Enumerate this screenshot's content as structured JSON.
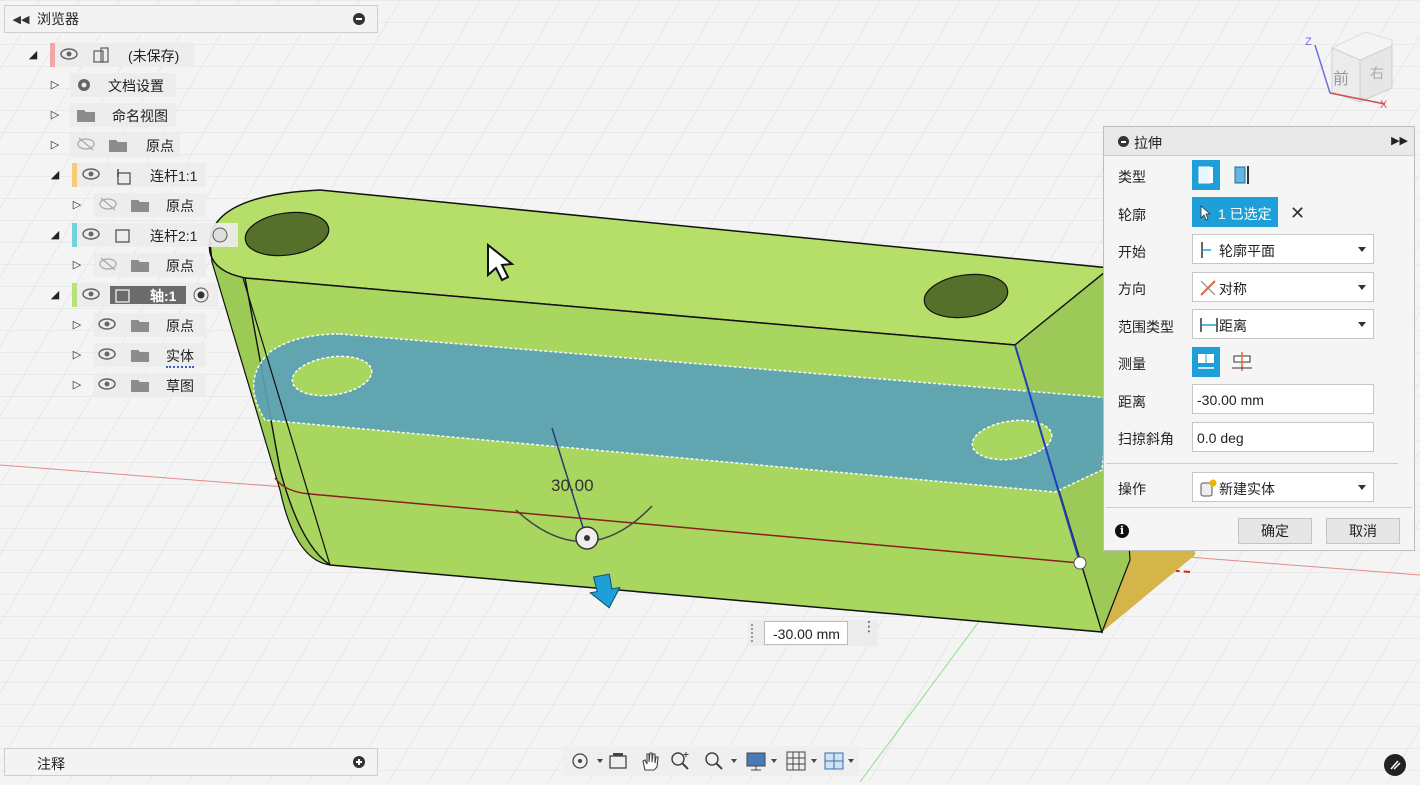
{
  "browser": {
    "title": "浏览器",
    "tree": [
      {
        "label": "(未保存)",
        "indent": 0,
        "color": "#f4a6a6"
      },
      {
        "label": "文档设置",
        "indent": 1
      },
      {
        "label": "命名视图",
        "indent": 1
      },
      {
        "label": "原点",
        "indent": 1
      },
      {
        "label": "连杆1:1",
        "indent": 1,
        "color": "#f7c97a"
      },
      {
        "label": "原点",
        "indent": 2
      },
      {
        "label": "连杆2:1",
        "indent": 1,
        "color": "#6fd3d8"
      },
      {
        "label": "原点",
        "indent": 2
      },
      {
        "label": "轴:1",
        "indent": 1,
        "color": "#b9e27a"
      },
      {
        "label": "原点",
        "indent": 2
      },
      {
        "label": "实体",
        "indent": 2
      },
      {
        "label": "草图",
        "indent": 2
      }
    ]
  },
  "notes": {
    "title": "注释"
  },
  "viewcube": {
    "front": "前",
    "right": "右",
    "axis_x": "X",
    "axis_z": "Z"
  },
  "viewport": {
    "dimension_label": "30.00",
    "dimension_input": "-30.00 mm"
  },
  "extrude": {
    "title": "拉伸",
    "rows": {
      "type": "类型",
      "profile": "轮廓",
      "start": "开始",
      "direction": "方向",
      "extent_type": "范围类型",
      "measure": "测量",
      "distance": "距离",
      "taper": "扫掠斜角",
      "operation": "操作"
    },
    "profile_selected": "1 已选定",
    "start_value": "轮廓平面",
    "direction_value": "对称",
    "extent_value": "距离",
    "distance_value": "-30.00 mm",
    "taper_value": "0.0 deg",
    "operation_value": "新建实体",
    "ok": "确定",
    "cancel": "取消"
  },
  "colors": {
    "accent": "#1e9fd8",
    "body_green": "#a6d45e",
    "profile_blue": "#5aa1b6"
  }
}
